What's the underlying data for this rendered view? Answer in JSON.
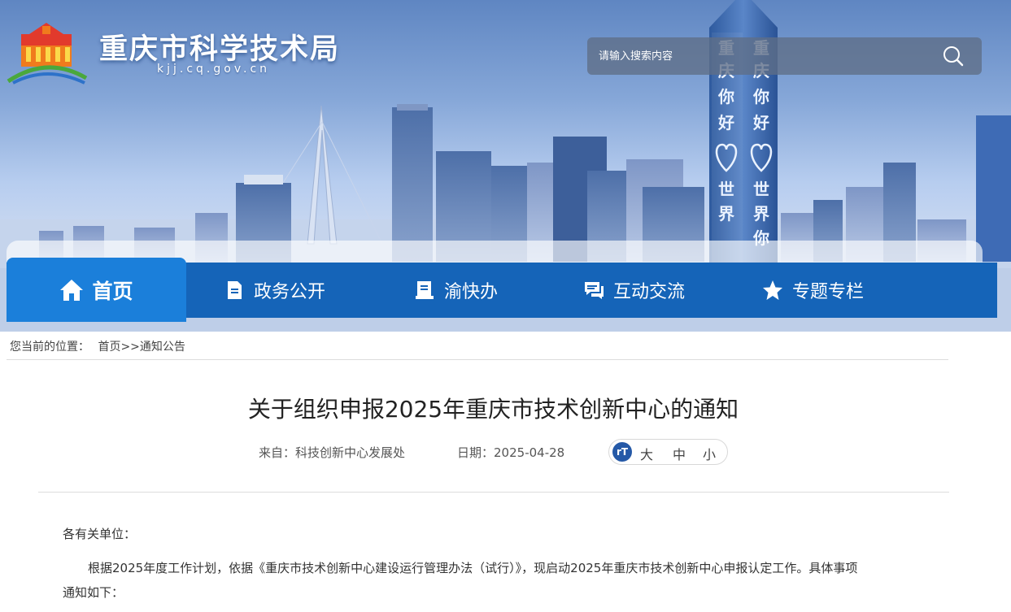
{
  "header": {
    "site_title": "重庆市科学技术局",
    "site_domain": "kjj.cq.gov.cn",
    "search_placeholder": "请输入搜索内容"
  },
  "nav": {
    "home": "首页",
    "items": [
      "政务公开",
      "渝快办",
      "互动交流",
      "专题专栏"
    ]
  },
  "tower_text": {
    "left": [
      "重",
      "庆",
      "你",
      "好",
      "世",
      "界"
    ],
    "right": [
      "重",
      "庆",
      "你",
      "好",
      "世",
      "界",
      "你"
    ]
  },
  "breadcrumb": {
    "label": "您当前的位置：",
    "home": "首页",
    "sep": ">>",
    "current": "通知公告"
  },
  "article": {
    "title": "关于组织申报2025年重庆市技术创新中心的通知",
    "source_label": "来自：",
    "source": "科技创新中心发展处",
    "date_label": "日期：",
    "date": "2025-04-28",
    "fontsize_icon": "rT",
    "fontsize_options": [
      "大",
      "中",
      "小"
    ],
    "salutation": "各有关单位：",
    "para1_line1": "根据2025年度工作计划，依据《重庆市技术创新中心建设运行管理办法（试行）》，现启动2025年重庆市技术创新中心申报认定工作。具体事项",
    "para1_line2": "通知如下："
  },
  "colors": {
    "nav_bg": "#1564b8",
    "nav_active": "#1b7fda",
    "fontsize_icon_bg": "#2559a7"
  },
  "icons": [
    "emblem-logo",
    "search-icon",
    "home-icon",
    "document-icon",
    "book-icon",
    "chat-icon",
    "star-icon"
  ]
}
